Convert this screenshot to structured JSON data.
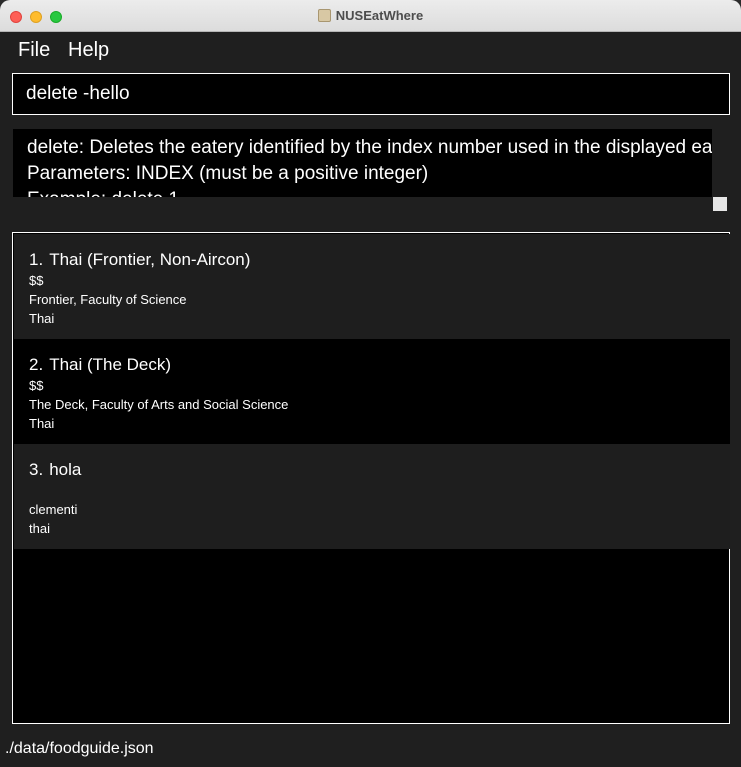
{
  "window": {
    "title": "NUSEatWhere"
  },
  "menu": {
    "file": "File",
    "help": "Help"
  },
  "command": {
    "value": "delete -hello"
  },
  "result": {
    "lines": [
      "delete: Deletes the eatery identified by the index number used in the displayed eatery list.",
      "Parameters: INDEX (must be a positive integer)",
      "Example: delete 1"
    ]
  },
  "eateries": [
    {
      "index": "1.",
      "name": "Thai (Frontier, Non-Aircon)",
      "price": "$$",
      "location": "Frontier, Faculty of Science",
      "category": "Thai"
    },
    {
      "index": "2.",
      "name": "Thai (The Deck)",
      "price": "$$",
      "location": "The Deck, Faculty of Arts and Social Science",
      "category": "Thai"
    },
    {
      "index": "3.",
      "name": "hola",
      "price": "",
      "location": "clementi",
      "category": "thai"
    }
  ],
  "status": {
    "path": "./data/foodguide.json"
  }
}
